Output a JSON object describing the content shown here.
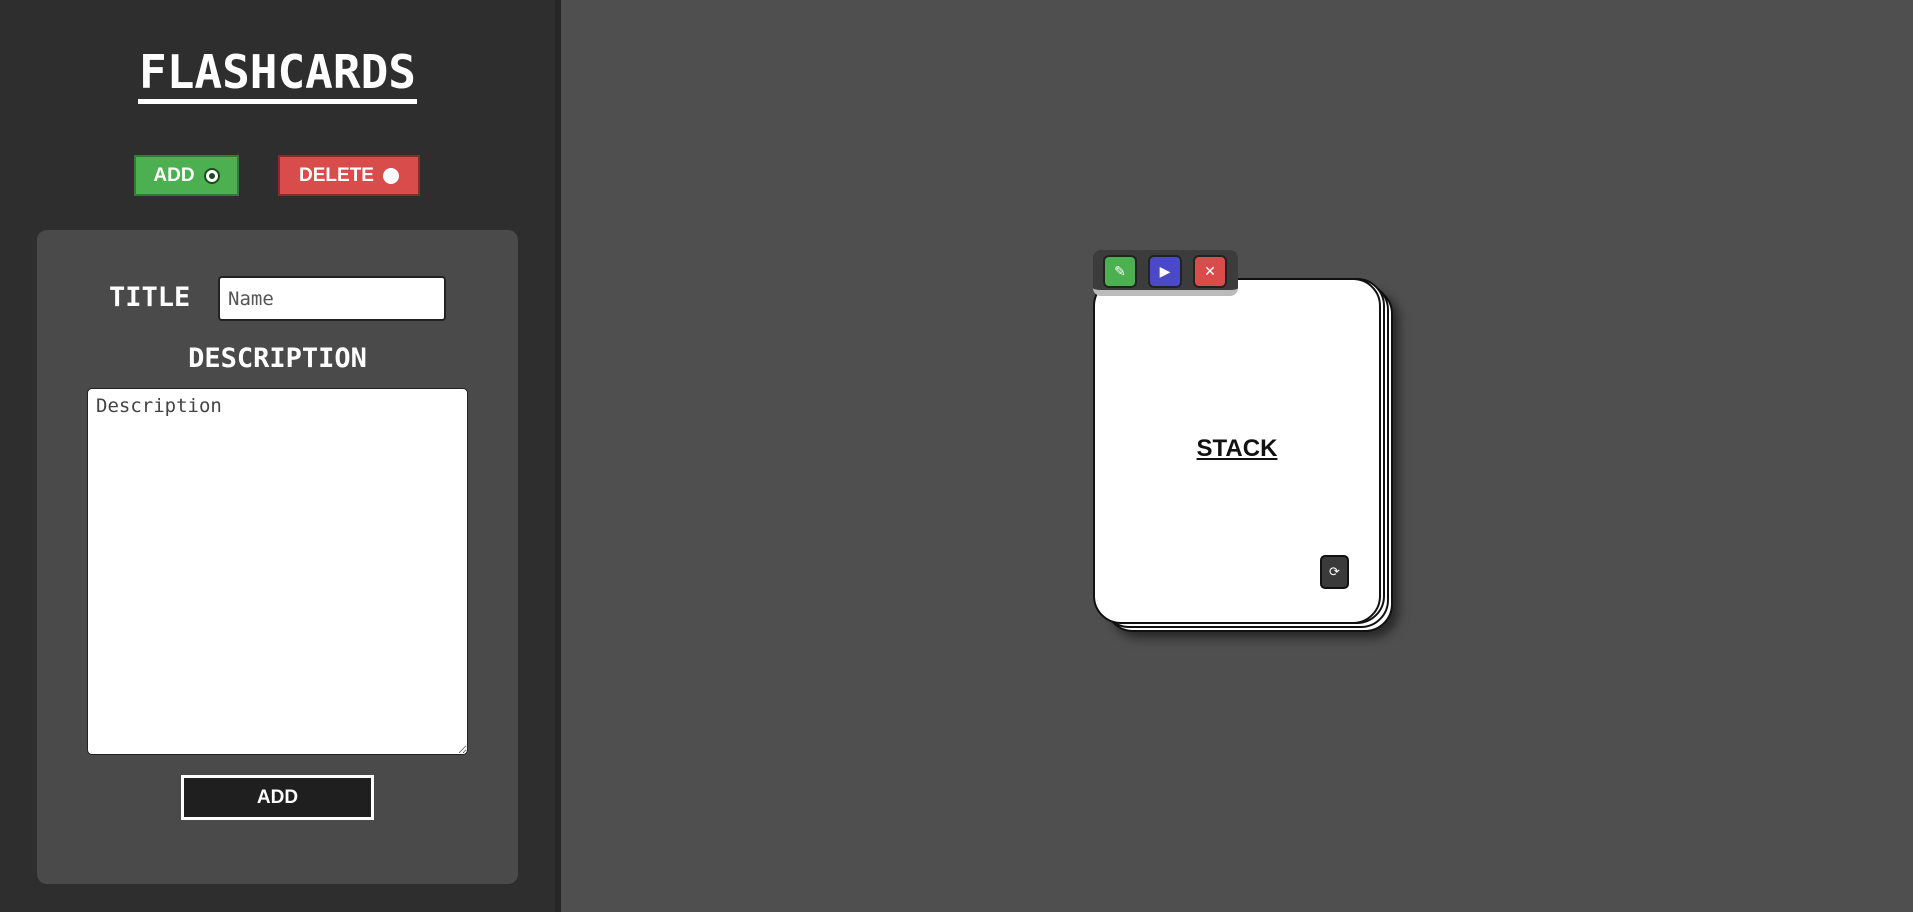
{
  "sidebar": {
    "app_title": "FLASHCARDS",
    "modes": {
      "add_label": "ADD",
      "add_selected": true,
      "delete_label": "DELETE",
      "delete_selected": false
    },
    "form": {
      "title_label": "TITLE",
      "title_value": "",
      "title_placeholder": "Name",
      "description_label": "DESCRIPTION",
      "description_value": "",
      "description_placeholder": "Description",
      "submit_label": "ADD"
    }
  },
  "stacks": [
    {
      "title": "STACK",
      "toolbar": {
        "edit_icon": "pencil-icon",
        "play_icon": "play-icon",
        "delete_icon": "close-icon"
      },
      "flip_icon": "refresh-icon"
    }
  ],
  "colors": {
    "add_green": "#4caf50",
    "delete_red": "#d94c4c",
    "play_blue": "#4a4ac8",
    "sidebar_bg": "#2e2e2e",
    "main_bg": "#4f4f4f"
  }
}
